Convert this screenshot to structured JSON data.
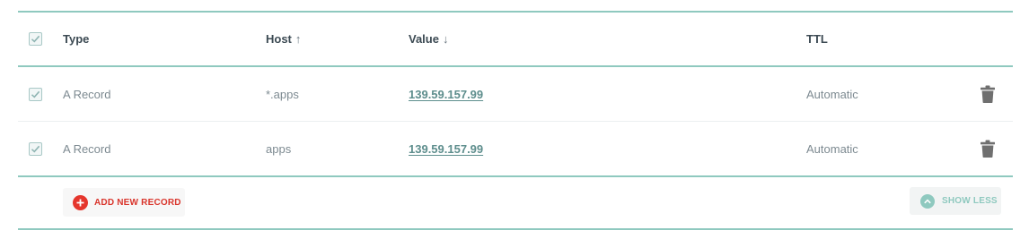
{
  "table": {
    "columns": {
      "type": "Type",
      "host": "Host",
      "host_sort": "↑",
      "value": "Value",
      "value_sort": "↓",
      "ttl": "TTL"
    },
    "select_all_checked": true,
    "rows": [
      {
        "checked": true,
        "type": "A Record",
        "host": "*.apps",
        "value": "139.59.157.99",
        "ttl": "Automatic",
        "delete_icon": "trash-icon"
      },
      {
        "checked": true,
        "type": "A Record",
        "host": "apps",
        "value": "139.59.157.99",
        "ttl": "Automatic",
        "delete_icon": "trash-icon"
      }
    ]
  },
  "footer": {
    "add_label": "ADD NEW RECORD",
    "add_icon": "plus-circle-icon",
    "show_less_label": "SHOW LESS",
    "show_less_icon": "chevron-up-circle-icon"
  },
  "colors": {
    "accent": "#8fc9bf",
    "link": "#5e8e8d",
    "danger": "#e5362d",
    "trash": "#6f6f6f"
  }
}
